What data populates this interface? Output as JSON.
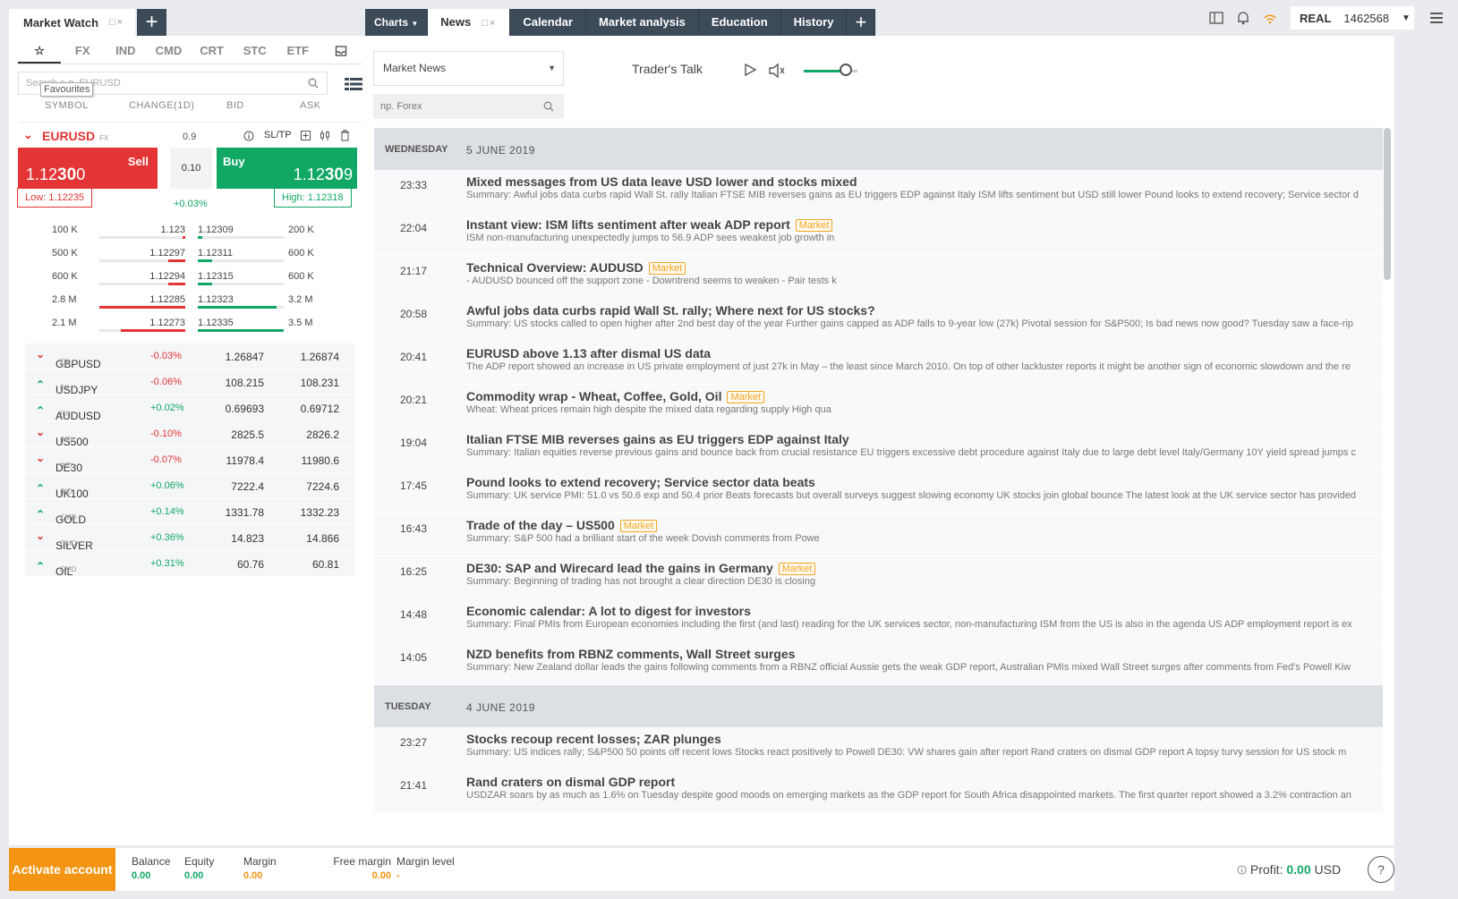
{
  "left_panel": {
    "title": "Market Watch",
    "categories": [
      "☆",
      "FX",
      "IND",
      "CMD",
      "CRT",
      "STC",
      "ETF"
    ],
    "search_text": "Search e.g. EURUSD",
    "tooltip": "Favourites",
    "columns": [
      "SYMBOL",
      "CHANGE(1D)",
      "BID",
      "ASK"
    ],
    "featured": {
      "symbol": "EURUSD",
      "type": "FX",
      "spread": "0.9",
      "sltp": "SL/TP",
      "sell_label": "Sell",
      "sell_price_prefix": "1.12",
      "sell_price_big": "30",
      "sell_price_suffix": "0",
      "volume": "0.10",
      "buy_label": "Buy",
      "buy_price_prefix": "1.12",
      "buy_price_big": "30",
      "buy_price_suffix": "9",
      "low": "Low: 1.12235",
      "high": "High: 1.12318",
      "change": "+0.03%",
      "depth": [
        {
          "bid_vol": "100 K",
          "bid": "1.123",
          "ask": "1.12309",
          "ask_vol": "200 K",
          "bid_level": 0.03,
          "ask_level": 0.05
        },
        {
          "bid_vol": "500 K",
          "bid": "1.12297",
          "ask": "1.12311",
          "ask_vol": "600 K",
          "bid_level": 0.2,
          "ask_level": 0.17
        },
        {
          "bid_vol": "600 K",
          "bid": "1.12294",
          "ask": "1.12315",
          "ask_vol": "600 K",
          "bid_level": 0.2,
          "ask_level": 0.17
        },
        {
          "bid_vol": "2.8 M",
          "bid": "1.12285",
          "ask": "1.12323",
          "ask_vol": "3.2 M",
          "bid_level": 1.0,
          "ask_level": 0.92
        },
        {
          "bid_vol": "2.1 M",
          "bid": "1.12273",
          "ask": "1.12335",
          "ask_vol": "3.5 M",
          "bid_level": 0.75,
          "ask_level": 1.0
        }
      ]
    },
    "instruments": [
      {
        "symbol": "GBPUSD",
        "type": "FX",
        "dir": "down",
        "change": "-0.03%",
        "bid": "1.26847",
        "ask": "1.26874"
      },
      {
        "symbol": "USDJPY",
        "type": "FX",
        "dir": "up",
        "change": "-0.06%",
        "bid": "108.215",
        "ask": "108.231"
      },
      {
        "symbol": "AUDUSD",
        "type": "FX",
        "dir": "up",
        "change": "+0.02%",
        "bid": "0.69693",
        "ask": "0.69712"
      },
      {
        "symbol": "US500",
        "type": "IND",
        "dir": "down",
        "change": "-0.10%",
        "bid": "2825.5",
        "ask": "2826.2"
      },
      {
        "symbol": "DE30",
        "type": "IND",
        "dir": "down",
        "change": "-0.07%",
        "bid": "11978.4",
        "ask": "11980.6"
      },
      {
        "symbol": "UK100",
        "type": "IND",
        "dir": "up",
        "change": "+0.06%",
        "bid": "7222.4",
        "ask": "7224.6"
      },
      {
        "symbol": "GOLD",
        "type": "CMD",
        "dir": "up",
        "change": "+0.14%",
        "bid": "1331.78",
        "ask": "1332.23"
      },
      {
        "symbol": "SILVER",
        "type": "CMD",
        "dir": "down",
        "change": "+0.36%",
        "bid": "14.823",
        "ask": "14.866"
      },
      {
        "symbol": "OIL",
        "type": "CMD",
        "dir": "up",
        "change": "+0.31%",
        "bid": "60.76",
        "ask": "60.81"
      }
    ]
  },
  "top_tabs": {
    "charts": "Charts",
    "news": "News",
    "calendar": "Calendar",
    "analysis": "Market analysis",
    "education": "Education",
    "history": "History"
  },
  "account": {
    "type": "REAL",
    "number": "1462568"
  },
  "news_panel": {
    "source": "Market News",
    "filter_placeholder": "np. Forex",
    "traders_talk": "Trader's Talk",
    "badge_label": "Market",
    "days": [
      {
        "weekday": "WEDNESDAY",
        "date": "5 JUNE 2019",
        "items": [
          {
            "time": "23:33",
            "title": "Mixed messages from US data leave USD lower and stocks mixed",
            "badge": false,
            "summary": "Summary: Awful jobs data curbs rapid Wall St. rally Italian FTSE MIB reverses gains as EU triggers EDP against Italy ISM lifts sentiment but USD still lower Pound looks to extend recovery; Service sector d"
          },
          {
            "time": "22:04",
            "title": "Instant view: ISM lifts sentiment after weak ADP report",
            "badge": true,
            "summary": "ISM non-manufacturing unexpectedly jumps to 56.9 ADP sees weakest job growth in"
          },
          {
            "time": "21:17",
            "title": "Technical Overview: AUDUSD",
            "badge": true,
            "summary": "- AUDUSD bounced off the support zone - Downtrend seems to weaken - Pair tests k"
          },
          {
            "time": "20:58",
            "title": "Awful jobs data curbs rapid Wall St. rally; Where next for US stocks?",
            "badge": false,
            "summary": "Summary: US stocks called to open higher after 2nd best day of the year Further gains capped as ADP falls to 9-year low (27k) Pivotal session for S&P500; Is bad news now good?   Tuesday saw a face-rip"
          },
          {
            "time": "20:41",
            "title": "EURUSD above 1.13 after dismal US data",
            "badge": false,
            "summary": "The ADP report showed an increase in US private employment of just 27k in May – the least since March 2010. On top of other lackluster reports it might be another sign of economic slowdown and the re"
          },
          {
            "time": "20:21",
            "title": "Commodity wrap - Wheat, Coffee, Gold, Oil",
            "badge": true,
            "summary": "Wheat: Wheat prices remain high despite the mixed data regarding supply High qua"
          },
          {
            "time": "19:04",
            "title": "Italian FTSE MIB reverses gains as EU triggers EDP against Italy",
            "badge": false,
            "summary": "Summary: Italian equities reverse previous gains and bounce back from crucial resistance EU triggers excessive debt procedure against Italy due to large debt level Italy/Germany 10Y yield spread jumps c"
          },
          {
            "time": "17:45",
            "title": "Pound looks to extend recovery; Service sector data beats",
            "badge": false,
            "summary": "Summary: UK service PMI: 51.0 vs 50.6 exp and 50.4 prior Beats forecasts but overall surveys suggest slowing economy UK stocks join global bounce The latest look at the UK service sector has provided"
          },
          {
            "time": "16:43",
            "title": "Trade of the day – US500",
            "badge": true,
            "summary": "Summary: S&P 500 had a brilliant start of the week Dovish comments from Powe"
          },
          {
            "time": "16:25",
            "title": "DE30: SAP and Wirecard lead the gains in Germany",
            "badge": true,
            "summary": "Summary: Beginning of trading has not brought a clear direction DE30 is closing"
          },
          {
            "time": "14:48",
            "title": "Economic calendar: A lot to digest for investors",
            "badge": false,
            "summary": "Summary: Final PMIs from European economies including the first (and last) reading for the UK services sector, non-manufacturing ISM from the US is also in the agenda US ADP employment report is ex"
          },
          {
            "time": "14:05",
            "title": "NZD benefits from RBNZ comments, Wall Street surges",
            "badge": false,
            "summary": "Summary: New Zealand dollar leads the gains following comments from a RBNZ official Aussie gets the weak GDP report, Australian PMIs mixed Wall Street surges after comments from Fed's Powell Kiw"
          }
        ]
      },
      {
        "weekday": "TUESDAY",
        "date": "4 JUNE 2019",
        "items": [
          {
            "time": "23:27",
            "title": "Stocks recoup recent losses; ZAR plunges",
            "badge": false,
            "summary": "Summary: US indices rally; S&P500 50 points off recent lows  Stocks react positively to Powell DE30: VW shares gain after report Rand craters on dismal GDP report   A topsy turvy session for US stock m"
          },
          {
            "time": "21:41",
            "title": "Rand craters on dismal GDP report",
            "badge": false,
            "summary": "USDZAR soars by as much as 1.6% on Tuesday despite good moods on emerging markets as the GDP report for South Africa disappointed markets. The first quarter report showed a 3.2% contraction an"
          }
        ]
      }
    ]
  },
  "bottom_bar": {
    "activate": "Activate account",
    "balance_label": "Balance",
    "balance": "0.00",
    "equity_label": "Equity",
    "equity": "0.00",
    "margin_label": "Margin",
    "margin": "0.00",
    "free_margin_label": "Free margin",
    "free_margin": "0.00",
    "margin_level_label": "Margin level",
    "margin_level": "-",
    "profit_label": "Profit:",
    "profit_value": "0.00",
    "profit_currency": "USD",
    "help": "?"
  },
  "colors": {
    "sell": "#e33535",
    "buy": "#11a765",
    "accent_orange": "#f39513",
    "tab_dark": "#3d4a58"
  }
}
